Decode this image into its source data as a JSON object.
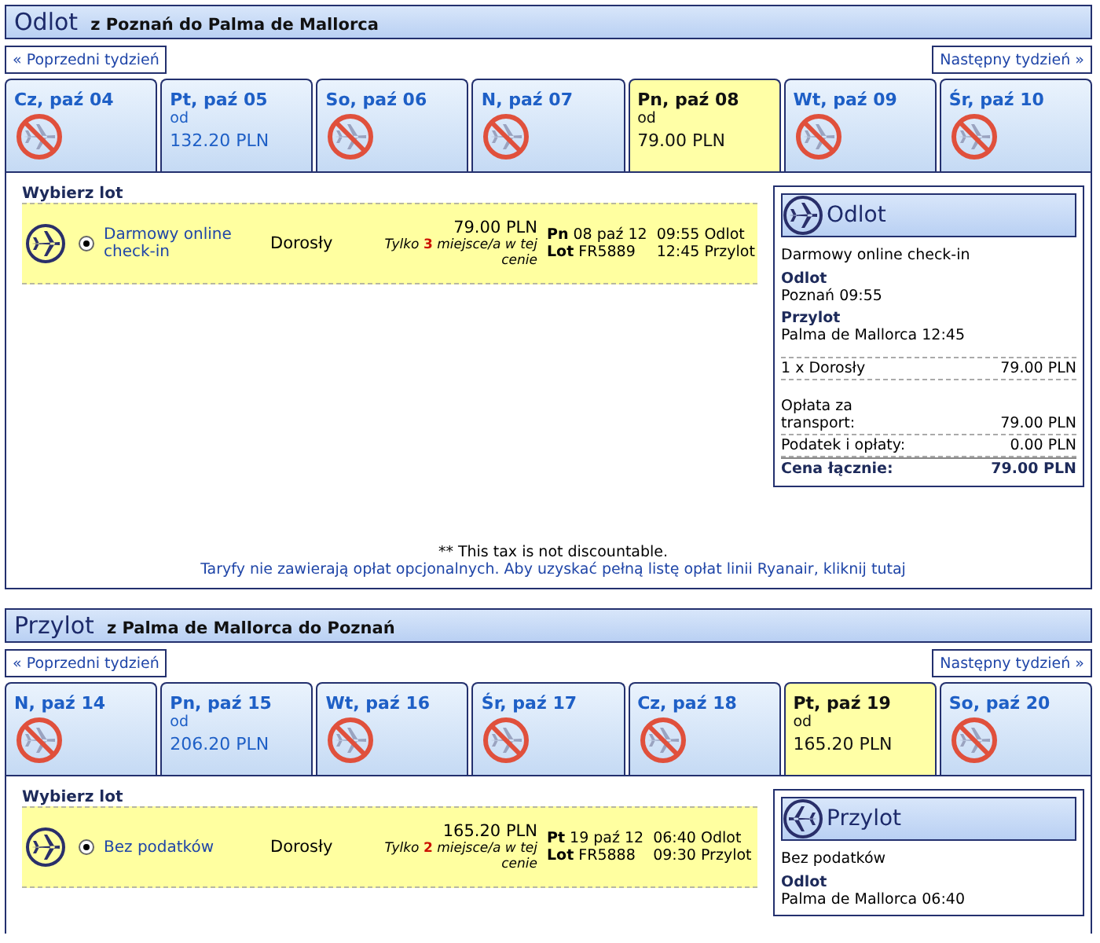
{
  "sections": [
    {
      "kind": "outbound",
      "title": "Odlot",
      "route": "z Poznań do Palma de Mallorca",
      "prev_week": "« Poprzedni tydzień",
      "next_week": "Następny tydzień »",
      "days": [
        {
          "label": "Cz, paź 04",
          "selected": false,
          "available": false
        },
        {
          "label": "Pt, paź 05",
          "selected": false,
          "available": true,
          "from": "od",
          "price": "132.20 PLN"
        },
        {
          "label": "So, paź 06",
          "selected": false,
          "available": false
        },
        {
          "label": "N, paź 07",
          "selected": false,
          "available": false
        },
        {
          "label": "Pn, paź 08",
          "selected": true,
          "available": true,
          "from": "od",
          "price": "79.00 PLN"
        },
        {
          "label": "Wt, paź 09",
          "selected": false,
          "available": false
        },
        {
          "label": "Śr, paź 10",
          "selected": false,
          "available": false
        }
      ],
      "choose_label": "Wybierz lot",
      "flights": [
        {
          "selected": true,
          "fare": "Darmowy online check-in",
          "passenger": "Dorosły",
          "price": "79.00 PLN",
          "note": "Tylko **3** miejsce/a w tej cenie",
          "day": "**Pn** 08 paź 12",
          "flight": "**Lot** FR5889",
          "departure_time": "09:55",
          "departure_label": "Odlot",
          "arrival_time": "12:45",
          "arrival_label": "Przylot"
        }
      ],
      "summary": {
        "title": "Odlot",
        "fare": "Darmowy online check-in",
        "legs": [
          {
            "label": "Odlot",
            "value": "Poznań 09:55"
          },
          {
            "label": "Przylot",
            "value": "Palma de Mallorca 12:45"
          }
        ],
        "lines": [
          {
            "kind": "passenger",
            "label": "1 x Dorosły",
            "amount": "79.00 PLN"
          },
          {
            "kind": "fee",
            "label": "Opłata za transport:",
            "amount": "79.00 PLN"
          },
          {
            "kind": "fee",
            "label": "Podatek i opłaty:",
            "amount": "0.00 PLN"
          },
          {
            "kind": "total",
            "label": "Cena łącznie:",
            "amount": "79.00 PLN"
          }
        ]
      },
      "notes": [
        {
          "kind": "text",
          "text": "** This tax is not discountable."
        },
        {
          "kind": "link",
          "text": "Taryfy nie zawierają opłat opcjonalnych. Aby uzyskać pełną listę opłat linii Ryanair, kliknij tutaj"
        }
      ]
    },
    {
      "kind": "inbound",
      "title": "Przylot",
      "route": "z Palma de Mallorca do Poznań",
      "prev_week": "« Poprzedni tydzień",
      "next_week": "Następny tydzień »",
      "days": [
        {
          "label": "N, paź 14",
          "selected": false,
          "available": false
        },
        {
          "label": "Pn, paź 15",
          "selected": false,
          "available": true,
          "from": "od",
          "price": "206.20 PLN"
        },
        {
          "label": "Wt, paź 16",
          "selected": false,
          "available": false
        },
        {
          "label": "Śr, paź 17",
          "selected": false,
          "available": false
        },
        {
          "label": "Cz, paź 18",
          "selected": false,
          "available": false
        },
        {
          "label": "Pt, paź 19",
          "selected": true,
          "available": true,
          "from": "od",
          "price": "165.20 PLN"
        },
        {
          "label": "So, paź 20",
          "selected": false,
          "available": false
        }
      ],
      "choose_label": "Wybierz lot",
      "flights": [
        {
          "selected": true,
          "fare": "Bez podatków",
          "passenger": "Dorosły",
          "price": "165.20 PLN",
          "note": "Tylko **2** miejsce/a w tej cenie",
          "day": "**Pt** 19 paź 12",
          "flight": "**Lot** FR5888",
          "departure_time": "06:40",
          "departure_label": "Odlot",
          "arrival_time": "09:30",
          "arrival_label": "Przylot"
        }
      ],
      "summary": {
        "title": "Przylot",
        "fare": "Bez podatków",
        "legs": [
          {
            "label": "Odlot",
            "value": "Palma de Mallorca 06:40"
          }
        ]
      }
    }
  ]
}
